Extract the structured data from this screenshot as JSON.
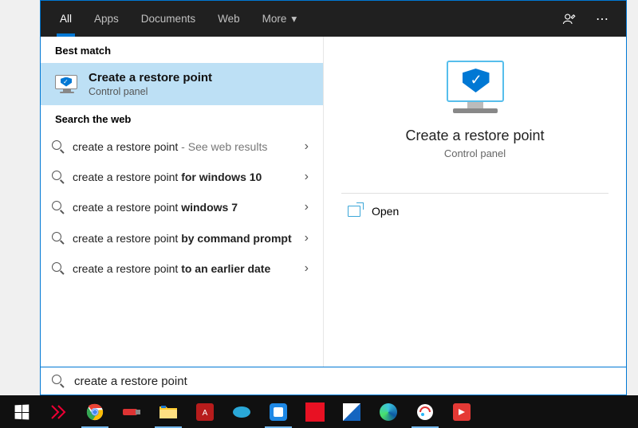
{
  "tabs": {
    "all": "All",
    "apps": "Apps",
    "documents": "Documents",
    "web": "Web",
    "more": "More"
  },
  "sections": {
    "best_match": "Best match",
    "search_web": "Search the web"
  },
  "best_match": {
    "title": "Create a restore point",
    "subtitle": "Control panel"
  },
  "web_results": [
    {
      "prefix": "create a restore point",
      "bold": "",
      "suffix": " - See web results"
    },
    {
      "prefix": "create a restore point ",
      "bold": "for windows 10",
      "suffix": ""
    },
    {
      "prefix": "create a restore point ",
      "bold": "windows 7",
      "suffix": ""
    },
    {
      "prefix": "create a restore point ",
      "bold": "by command prompt",
      "suffix": ""
    },
    {
      "prefix": "create a restore point ",
      "bold": "to an earlier date",
      "suffix": ""
    }
  ],
  "detail": {
    "title": "Create a restore point",
    "subtitle": "Control panel",
    "open_label": "Open"
  },
  "search_query": "create a restore point"
}
